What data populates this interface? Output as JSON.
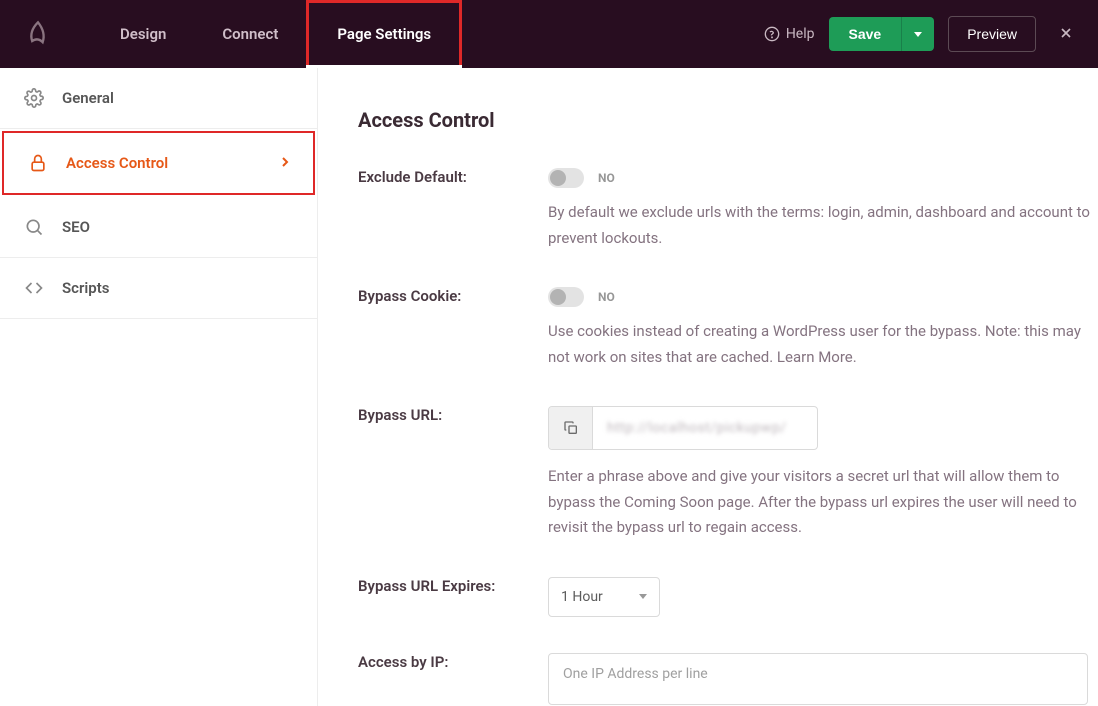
{
  "header": {
    "tabs": {
      "design": "Design",
      "connect": "Connect",
      "page_settings": "Page Settings"
    },
    "help": "Help",
    "save": "Save",
    "preview": "Preview"
  },
  "sidebar": {
    "general": "General",
    "access_control": "Access Control",
    "seo": "SEO",
    "scripts": "Scripts"
  },
  "main": {
    "title": "Access Control",
    "exclude_default": {
      "label": "Exclude Default:",
      "toggle": "NO",
      "help": "By default we exclude urls with the terms: login, admin, dashboard and account to prevent lockouts."
    },
    "bypass_cookie": {
      "label": "Bypass Cookie:",
      "toggle": "NO",
      "help": "Use cookies instead of creating a WordPress user for the bypass. Note: this may not work on sites that are cached. Learn More."
    },
    "bypass_url": {
      "label": "Bypass URL:",
      "value": "http://localhost/pickupwp/",
      "help": "Enter a phrase above and give your visitors a secret url that will allow them to bypass the Coming Soon page. After the bypass url expires the user will need to revisit the bypass url to regain access."
    },
    "bypass_expires": {
      "label": "Bypass URL Expires:",
      "value": "1 Hour"
    },
    "access_ip": {
      "label": "Access by IP:",
      "placeholder": "One IP Address per line"
    }
  }
}
